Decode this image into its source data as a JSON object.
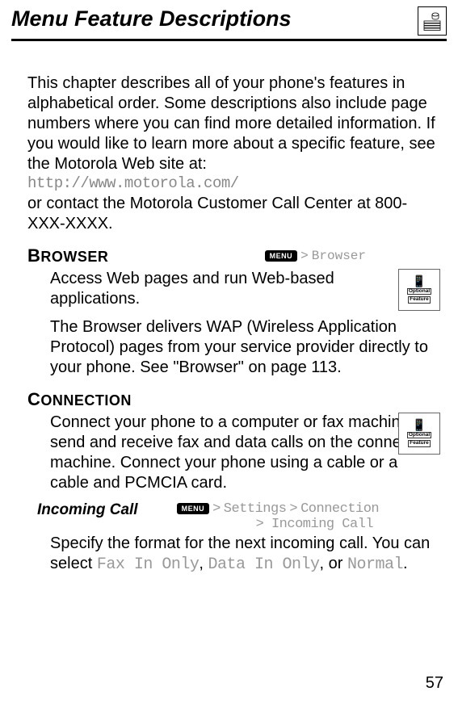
{
  "page": {
    "title": "Menu Feature Descriptions",
    "number": "57"
  },
  "intro": {
    "p1": "This chapter describes all of your phone's features in alphabetical order. Some descriptions also include page numbers where you can find more detailed information. If you would like to learn more about a specific feature, see the Motorola Web site at:",
    "url": "http://www.motorola.com/",
    "p2": "or contact the Motorola Customer Call Center at 800-XXX-XXXX."
  },
  "browser": {
    "heading_caps": "B",
    "heading_rest": "ROWSER",
    "menu_label": "MENU",
    "sep": ">",
    "path": "Browser",
    "desc1": "Access Web pages and run Web-based applications.",
    "desc2": "The Browser delivers WAP (Wireless Application Protocol) pages from your service provider directly to your phone. See \"Browser\" on page 113.",
    "optional1": "Optional",
    "optional2": "Feature"
  },
  "connection": {
    "heading_caps": "C",
    "heading_rest": "ONNECTION",
    "desc1": "Connect your phone to a computer or fax machine to send and receive fax and data calls on the connected machine. Connect your phone using a cable or a cable and PCMCIA card.",
    "optional1": "Optional",
    "optional2": "Feature"
  },
  "incoming": {
    "heading": "Incoming Call",
    "menu_label": "MENU",
    "sep": ">",
    "path1": "Settings",
    "path2": "Connection",
    "path3": "Incoming Call",
    "desc_prefix": "Specify the format for the next incoming call. You can select ",
    "opt1": "Fax In Only",
    "comma1": ", ",
    "opt2": "Data In Only",
    "comma2": ", or ",
    "opt3": "Normal",
    "period": "."
  }
}
